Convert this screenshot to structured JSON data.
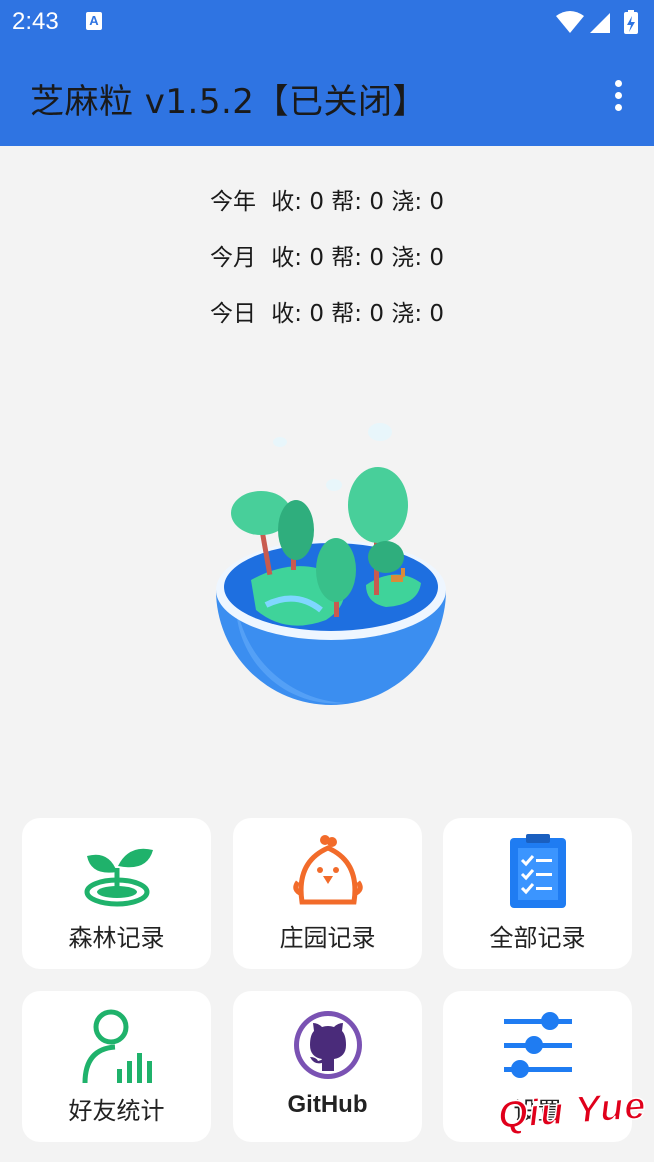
{
  "status_bar": {
    "time": "2:43",
    "notification_badge": "A",
    "icons": [
      "wifi-icon",
      "cellular-icon",
      "battery-charging-icon"
    ]
  },
  "app_bar": {
    "title": "芝麻粒 v1.5.2【已关闭】",
    "menu_icon": "more-vert-icon"
  },
  "stats": [
    {
      "period": "今年",
      "collect": "收: 0",
      "help": "帮: 0",
      "water": "浇: 0"
    },
    {
      "period": "今月",
      "collect": "收: 0",
      "help": "帮: 0",
      "water": "浇: 0"
    },
    {
      "period": "今日",
      "collect": "收: 0",
      "help": "帮: 0",
      "water": "浇: 0"
    }
  ],
  "illustration": "forest-globe-illustration",
  "tiles": [
    {
      "label": "森林记录",
      "icon": "sprout-icon"
    },
    {
      "label": "庄园记录",
      "icon": "chick-icon"
    },
    {
      "label": "全部记录",
      "icon": "clipboard-checklist-icon"
    },
    {
      "label": "好友统计",
      "icon": "friend-stats-icon"
    },
    {
      "label": "GitHub",
      "icon": "github-icon"
    },
    {
      "label": "设置",
      "icon": "sliders-icon"
    }
  ],
  "watermark": "Qiu Yue",
  "colors": {
    "primary": "#2f74e2",
    "background": "#f3f3f3",
    "tile": "#ffffff",
    "green": "#1fb26b",
    "orange": "#f26b2a",
    "blue": "#1f7cf2",
    "purple": "#6b3fa0"
  }
}
